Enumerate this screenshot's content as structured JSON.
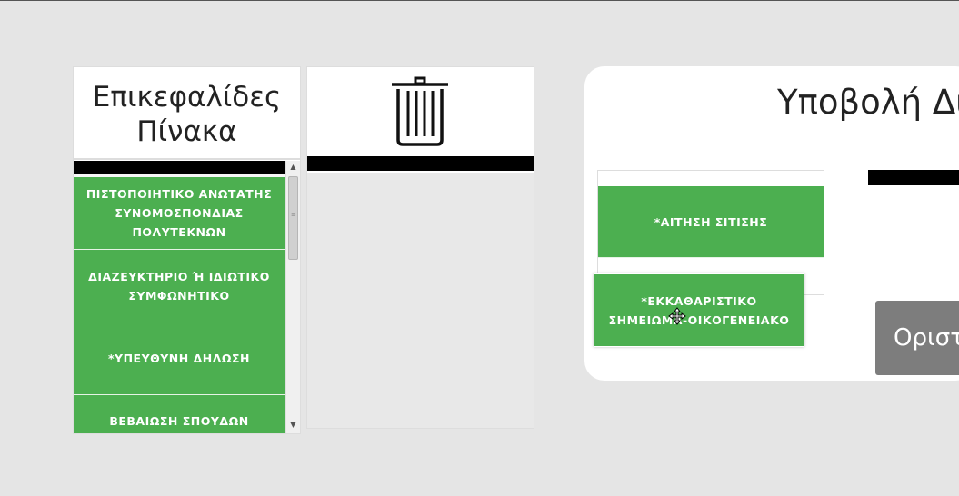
{
  "headers_panel": {
    "title_line1": "Επικεφαλίδες",
    "title_line2": "Πίνακα",
    "items": [
      "ΠΙΣΤΟΠΟΙΗΤΙΚΟ ΑΝΩΤΑΤΗΣ ΣΥΝΟΜΟΣΠΟΝΔΙΑΣ ΠΟΛΥΤΕΚΝΩΝ",
      "ΔΙΑΖΕΥΚΤΗΡΙΟ Ή ΙΔΙΩΤΙΚΟ ΣΥΜΦΩΝΗΤΙΚΟ",
      "*ΥΠΕΥΘΥΝΗ ΔΗΛΩΣΗ",
      "ΒΕΒΑΙΩΣΗ ΣΠΟΥΔΩΝ ΑΔΕΛΦΟΥ-"
    ]
  },
  "trash_panel": {
    "icon": "trash-icon"
  },
  "submission": {
    "title": "Υποβολή Δι",
    "dropped_item": "*ΑΙΤΗΣΗ ΣΙΤΙΣΗΣ",
    "button_label": "Οριστ"
  },
  "dragging_item": {
    "label": "*ΕΚΚΑΘΑΡΙΣΤΙΚΟ ΣΗΜΕΙΩΜΑ-ΟΙΚΟΓΕΝΕΙΑΚΟ"
  },
  "colors": {
    "accent_green": "#4caf50",
    "button_gray": "#7d7d7d",
    "background": "#e5e5e5"
  }
}
